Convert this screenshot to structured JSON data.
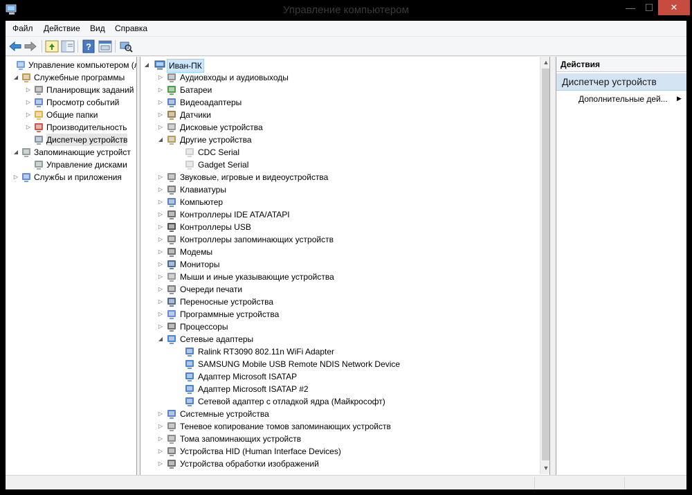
{
  "window": {
    "title": "Управление компьютером",
    "min_glyph": "—",
    "max_glyph": "☐",
    "close_glyph": "✕"
  },
  "menu": [
    "Файл",
    "Действие",
    "Вид",
    "Справка"
  ],
  "toolbar": {
    "icons": [
      "back-icon",
      "forward-icon",
      "up-folder-icon",
      "console-tree-icon",
      "help-icon",
      "properties-icon",
      "scan-hardware-icon"
    ]
  },
  "left_tree": [
    {
      "label": "Управление компьютером (л",
      "icon": "computer-management-icon",
      "level": 0,
      "arrow": ""
    },
    {
      "label": "Служебные программы",
      "icon": "tools-icon",
      "level": 1,
      "arrow": "down"
    },
    {
      "label": "Планировщик заданий",
      "icon": "clock-icon",
      "level": 2,
      "arrow": "right"
    },
    {
      "label": "Просмотр событий",
      "icon": "event-viewer-icon",
      "level": 2,
      "arrow": "right"
    },
    {
      "label": "Общие папки",
      "icon": "shared-folder-icon",
      "level": 2,
      "arrow": "right"
    },
    {
      "label": "Производительность",
      "icon": "performance-icon",
      "level": 2,
      "arrow": "right"
    },
    {
      "label": "Диспетчер устройств",
      "icon": "device-manager-icon",
      "level": 2,
      "arrow": "",
      "selected": true
    },
    {
      "label": "Запоминающие устройст",
      "icon": "storage-icon",
      "level": 1,
      "arrow": "down"
    },
    {
      "label": "Управление дисками",
      "icon": "disk-management-icon",
      "level": 2,
      "arrow": ""
    },
    {
      "label": "Службы и приложения",
      "icon": "services-icon",
      "level": 1,
      "arrow": "right"
    }
  ],
  "device_tree": {
    "root": "Иван-ПК",
    "items": [
      {
        "label": "Аудиовходы и аудиовыходы",
        "icon": "speaker-icon",
        "level": 1,
        "arrow": "right"
      },
      {
        "label": "Батареи",
        "icon": "battery-icon",
        "level": 1,
        "arrow": "right"
      },
      {
        "label": "Видеоадаптеры",
        "icon": "display-adapter-icon",
        "level": 1,
        "arrow": "right"
      },
      {
        "label": "Датчики",
        "icon": "sensor-icon",
        "level": 1,
        "arrow": "right"
      },
      {
        "label": "Дисковые устройства",
        "icon": "disk-drive-icon",
        "level": 1,
        "arrow": "right"
      },
      {
        "label": "Другие устройства",
        "icon": "other-devices-icon",
        "level": 1,
        "arrow": "down"
      },
      {
        "label": "CDC Serial",
        "icon": "unknown-device-icon",
        "level": 2,
        "arrow": ""
      },
      {
        "label": "Gadget Serial",
        "icon": "unknown-device-icon",
        "level": 2,
        "arrow": ""
      },
      {
        "label": "Звуковые, игровые и видеоустройства",
        "icon": "sound-icon",
        "level": 1,
        "arrow": "right"
      },
      {
        "label": "Клавиатуры",
        "icon": "keyboard-icon",
        "level": 1,
        "arrow": "right"
      },
      {
        "label": "Компьютер",
        "icon": "computer-icon",
        "level": 1,
        "arrow": "right"
      },
      {
        "label": "Контроллеры IDE ATA/ATAPI",
        "icon": "ide-controller-icon",
        "level": 1,
        "arrow": "right"
      },
      {
        "label": "Контроллеры USB",
        "icon": "usb-icon",
        "level": 1,
        "arrow": "right"
      },
      {
        "label": "Контроллеры запоминающих устройств",
        "icon": "storage-controller-icon",
        "level": 1,
        "arrow": "right"
      },
      {
        "label": "Модемы",
        "icon": "modem-icon",
        "level": 1,
        "arrow": "right"
      },
      {
        "label": "Мониторы",
        "icon": "monitor-icon",
        "level": 1,
        "arrow": "right"
      },
      {
        "label": "Мыши и иные указывающие устройства",
        "icon": "mouse-icon",
        "level": 1,
        "arrow": "right"
      },
      {
        "label": "Очереди печати",
        "icon": "printer-icon",
        "level": 1,
        "arrow": "right"
      },
      {
        "label": "Переносные устройства",
        "icon": "portable-device-icon",
        "level": 1,
        "arrow": "right"
      },
      {
        "label": "Программные устройства",
        "icon": "software-device-icon",
        "level": 1,
        "arrow": "right"
      },
      {
        "label": "Процессоры",
        "icon": "processor-icon",
        "level": 1,
        "arrow": "right"
      },
      {
        "label": "Сетевые адаптеры",
        "icon": "network-adapter-icon",
        "level": 1,
        "arrow": "down"
      },
      {
        "label": "Ralink RT3090 802.11n WiFi Adapter",
        "icon": "network-adapter-icon",
        "level": 2,
        "arrow": ""
      },
      {
        "label": "SAMSUNG Mobile USB Remote NDIS Network Device",
        "icon": "network-adapter-icon",
        "level": 2,
        "arrow": ""
      },
      {
        "label": "Адаптер Microsoft ISATAP",
        "icon": "network-adapter-icon",
        "level": 2,
        "arrow": ""
      },
      {
        "label": "Адаптер Microsoft ISATAP #2",
        "icon": "network-adapter-icon",
        "level": 2,
        "arrow": ""
      },
      {
        "label": "Сетевой адаптер с отладкой ядра (Майкрософт)",
        "icon": "network-adapter-icon",
        "level": 2,
        "arrow": ""
      },
      {
        "label": "Системные устройства",
        "icon": "system-device-icon",
        "level": 1,
        "arrow": "right"
      },
      {
        "label": "Теневое копирование томов запоминающих устройств",
        "icon": "volume-shadow-icon",
        "level": 1,
        "arrow": "right"
      },
      {
        "label": "Тома запоминающих устройств",
        "icon": "storage-volume-icon",
        "level": 1,
        "arrow": "right"
      },
      {
        "label": "Устройства HID (Human Interface Devices)",
        "icon": "hid-icon",
        "level": 1,
        "arrow": "right"
      },
      {
        "label": "Устройства обработки изображений",
        "icon": "imaging-device-icon",
        "level": 1,
        "arrow": "right"
      }
    ]
  },
  "actions": {
    "header": "Действия",
    "group": "Диспетчер устройств",
    "more": "Дополнительные дей..."
  },
  "colors": {
    "accent_selection": "#cce8ff",
    "actions_group_bg": "#d5e4f3",
    "close_button": "#c74b3f"
  }
}
